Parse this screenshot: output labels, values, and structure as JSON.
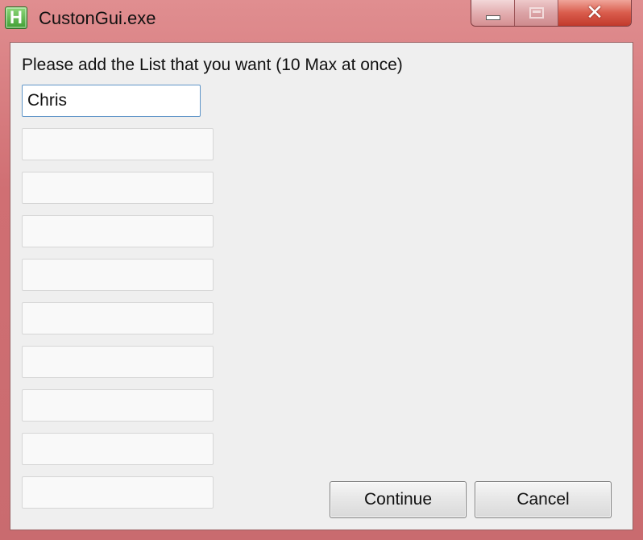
{
  "window": {
    "title": "CustonGui.exe",
    "icon": "app-h-icon",
    "icon_letter": "H",
    "close_glyph": "✕"
  },
  "form": {
    "prompt": "Please add the List that you want (10 Max at once)",
    "fields": [
      {
        "value": "Chris"
      },
      {
        "value": ""
      },
      {
        "value": ""
      },
      {
        "value": ""
      },
      {
        "value": ""
      },
      {
        "value": ""
      },
      {
        "value": ""
      },
      {
        "value": ""
      },
      {
        "value": ""
      },
      {
        "value": ""
      }
    ]
  },
  "buttons": {
    "continue_label": "Continue",
    "cancel_label": "Cancel"
  },
  "colors": {
    "titlebar": "#d06f73",
    "client_bg": "#efefef",
    "focus_border": "#5f95c8"
  }
}
